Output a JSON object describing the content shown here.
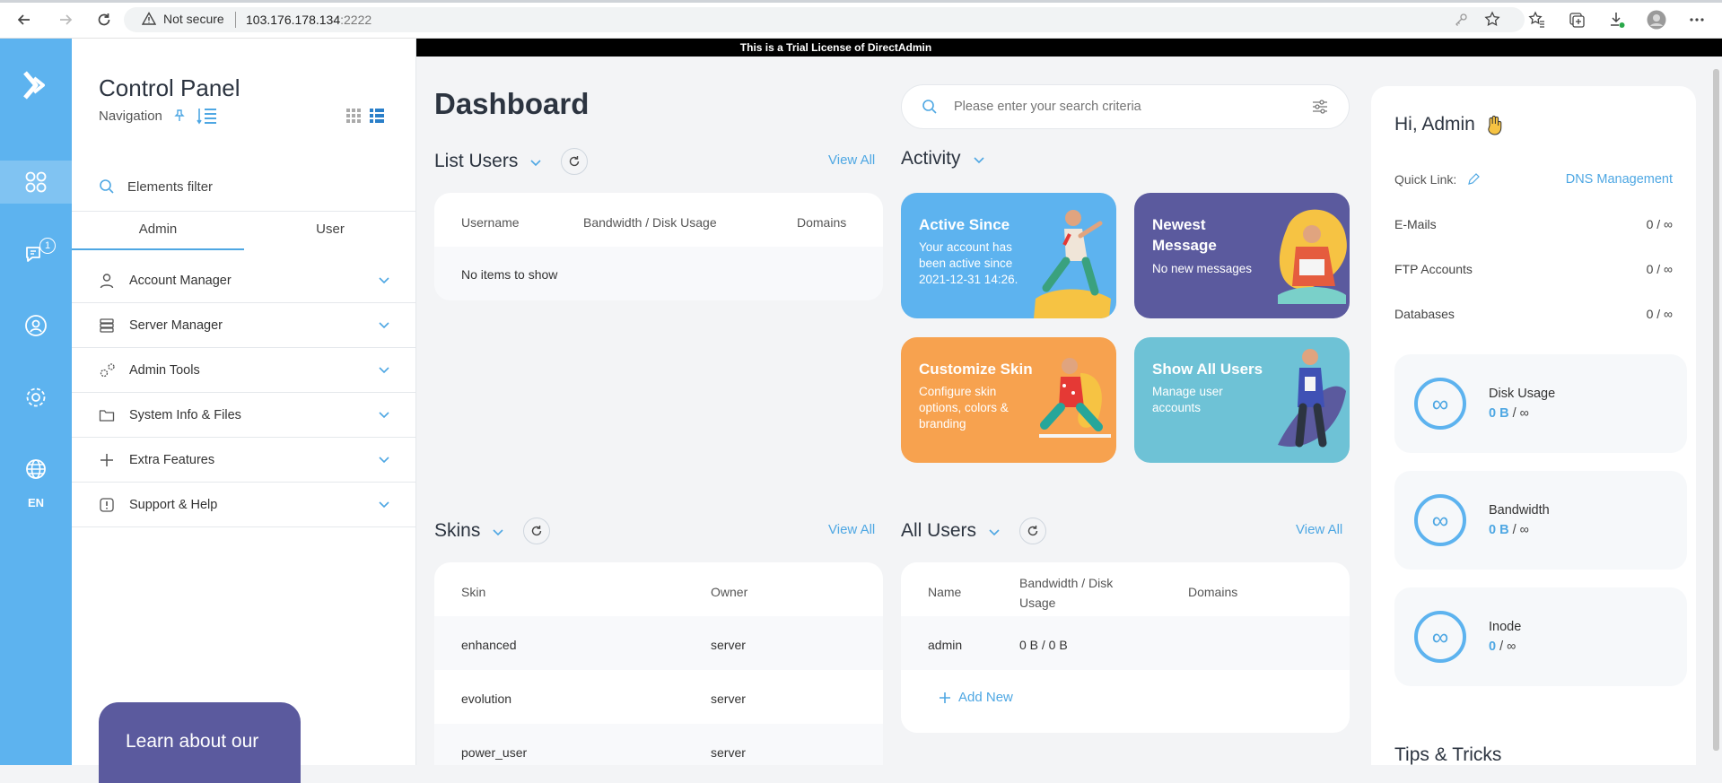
{
  "browser": {
    "not_secure": "Not secure",
    "url_host": "103.176.178.134",
    "url_port": ":2222"
  },
  "rail": {
    "lang": "EN",
    "messages_badge": "1",
    "accent": "#5db3ef"
  },
  "nav": {
    "title": "Control Panel",
    "subtitle": "Navigation",
    "filter_placeholder": "Elements filter",
    "tabs": [
      "Admin",
      "User"
    ],
    "items": [
      {
        "label": "Account Manager",
        "icon": "user-icon"
      },
      {
        "label": "Server Manager",
        "icon": "server-icon"
      },
      {
        "label": "Admin Tools",
        "icon": "gears-icon"
      },
      {
        "label": "System Info & Files",
        "icon": "folder-icon"
      },
      {
        "label": "Extra Features",
        "icon": "plus-icon"
      },
      {
        "label": "Support & Help",
        "icon": "alert-icon"
      }
    ],
    "learn_text": "Learn about our"
  },
  "trial_banner": "This is a Trial License of DirectAdmin",
  "main": {
    "title": "Dashboard",
    "search_placeholder": "Please enter your search criteria",
    "list_users": {
      "title": "List Users",
      "view_all": "View All",
      "headers": [
        "Username",
        "Bandwidth / Disk Usage",
        "Domains"
      ],
      "empty": "No items to show"
    },
    "activity": {
      "title": "Activity",
      "tiles": [
        {
          "title": "Active Since",
          "text": "Your account has been active since 2021-12-31 14:26.",
          "color": "#5db3ef"
        },
        {
          "title": "Newest Message",
          "text": "No new messages",
          "color": "#5b5a9e"
        },
        {
          "title": "Customize Skin",
          "text": "Configure skin options, colors & branding",
          "color": "#f7a24f"
        },
        {
          "title": "Show All Users",
          "text": "Manage user accounts",
          "color": "#6ec2d6"
        }
      ]
    },
    "skins": {
      "title": "Skins",
      "view_all": "View All",
      "headers": [
        "Skin",
        "Owner"
      ],
      "rows": [
        {
          "skin": "enhanced",
          "owner": "server"
        },
        {
          "skin": "evolution",
          "owner": "server"
        },
        {
          "skin": "power_user",
          "owner": "server"
        }
      ]
    },
    "all_users": {
      "title": "All Users",
      "view_all": "View All",
      "headers": [
        "Name",
        "Bandwidth / Disk Usage",
        "Domains"
      ],
      "rows": [
        {
          "name": "admin",
          "usage": "0 B / 0 B"
        }
      ],
      "add_new": "Add New"
    }
  },
  "right": {
    "greeting": "Hi, Admin",
    "quick_link_label": "Quick Link:",
    "quick_link": "DNS Management",
    "stats": [
      {
        "label": "E-Mails",
        "value": "0 / ∞"
      },
      {
        "label": "FTP Accounts",
        "value": "0 / ∞"
      },
      {
        "label": "Databases",
        "value": "0 / ∞"
      }
    ],
    "usage": [
      {
        "label": "Disk Usage",
        "used": "0 B",
        "limit": "/ ∞"
      },
      {
        "label": "Bandwidth",
        "used": "0 B",
        "limit": "/ ∞"
      },
      {
        "label": "Inode",
        "used": "0",
        "limit": "/ ∞"
      }
    ],
    "tips": "Tips & Tricks"
  }
}
